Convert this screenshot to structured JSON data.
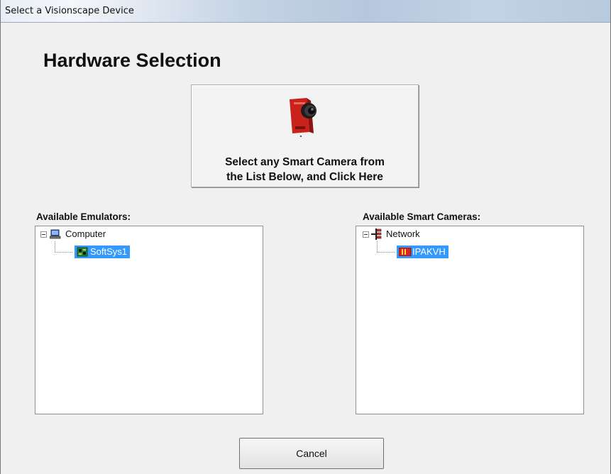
{
  "window": {
    "title": "Select a Visionscape Device"
  },
  "heading": "Hardware Selection",
  "select_button": {
    "label": "Select any Smart Camera from\nthe List Below, and Click Here",
    "icon": "smart-camera-icon"
  },
  "emulators": {
    "label": "Available Emulators:",
    "root": {
      "label": "Computer",
      "icon": "computer-icon",
      "expanded": true
    },
    "children": [
      {
        "label": "SoftSys1",
        "icon": "circuit-board-icon",
        "selected": true
      }
    ]
  },
  "cameras": {
    "label": "Available Smart Cameras:",
    "root": {
      "label": "Network",
      "icon": "network-icon",
      "expanded": true
    },
    "children": [
      {
        "label": "IPAKVH",
        "icon": "camera-device-icon",
        "selected": true
      }
    ]
  },
  "cancel_button": {
    "label": "Cancel"
  },
  "colors": {
    "selection": "#3399ff",
    "camera_body": "#d7261e"
  }
}
